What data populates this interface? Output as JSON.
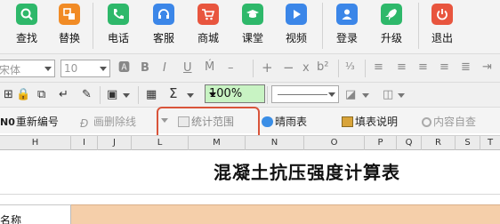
{
  "ribbon": {
    "buttons": [
      {
        "label": "查找",
        "icon": "search-icon",
        "color": "#2eb86a"
      },
      {
        "label": "替换",
        "icon": "replace-icon",
        "color": "#f18b25"
      },
      {
        "label": "电话",
        "icon": "phone-icon",
        "color": "#2eb86a"
      },
      {
        "label": "客服",
        "icon": "headset-icon",
        "color": "#3b86e8"
      },
      {
        "label": "商城",
        "icon": "cart-icon",
        "color": "#e8553e"
      },
      {
        "label": "课堂",
        "icon": "graduation-cap-icon",
        "color": "#2eb86a"
      },
      {
        "label": "视频",
        "icon": "play-icon",
        "color": "#3b86e8"
      },
      {
        "label": "登录",
        "icon": "user-icon",
        "color": "#3b86e8"
      },
      {
        "label": "升级",
        "icon": "rocket-icon",
        "color": "#2eb86a"
      },
      {
        "label": "退出",
        "icon": "power-icon",
        "color": "#e8553e"
      }
    ]
  },
  "format_toolbar": {
    "font_name": "宋体",
    "font_size": "10",
    "zoom": "100%"
  },
  "custom_toolbar": {
    "renumber": "重新编号",
    "strikethrough_delete": "画删除线",
    "stat_range": "统计范围",
    "weather_table": "晴雨表",
    "fill_instructions": "填表说明",
    "content_check": "内容自查"
  },
  "columns": [
    "H",
    "I",
    "J",
    "L",
    "M",
    "N",
    "O",
    "P",
    "Q",
    "R",
    "S",
    "T"
  ],
  "sheet": {
    "title": "混凝土抗压强度计算表",
    "name_label": "名称"
  },
  "colors": {
    "highlight": "#d9543a",
    "zoom_bg": "#c8f3c3",
    "cell_fill": "#f5cfaa"
  }
}
